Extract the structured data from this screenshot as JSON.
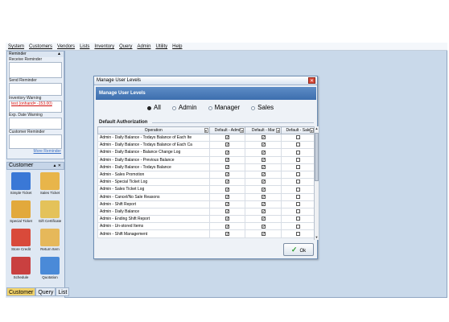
{
  "menu": [
    "System",
    "Customers",
    "Vendors",
    "Lists",
    "Inventory",
    "Query",
    "Admin",
    "Utility",
    "Help"
  ],
  "reminder": {
    "title": "Reminder",
    "receive": "Receive Reminder",
    "send": "Send Reminder",
    "inventory_warning": "Inventory Warning",
    "inventory_warning_item": "test (onhand= -153.00)",
    "exp_date_warning": "Exp. Date Warning",
    "customer_reminder": "Customer Reminder",
    "more_link": "More Reminder"
  },
  "customer_panel": {
    "title": "Customer",
    "tiles": [
      {
        "label": "Simple Ticket",
        "color": "#3a78d6"
      },
      {
        "label": "Sales Ticket",
        "color": "#e8b54a"
      },
      {
        "label": "Special Ticket",
        "color": "#e2a93c"
      },
      {
        "label": "Gift Certificate",
        "color": "#e4c25a"
      },
      {
        "label": "Store Credit",
        "color": "#d94a3a"
      },
      {
        "label": "Return Item",
        "color": "#e6b85a"
      },
      {
        "label": "Schedule",
        "color": "#c94040"
      },
      {
        "label": "Quotation",
        "color": "#4a8ad8"
      }
    ],
    "tabs": [
      "Customer",
      "Query",
      "List"
    ],
    "active_tab": "Customer"
  },
  "dialog": {
    "title": "Manage User Levels",
    "banner": "Manage User Levels",
    "radios": [
      {
        "label": "All",
        "checked": true
      },
      {
        "label": "Admin",
        "checked": false
      },
      {
        "label": "Manager",
        "checked": false
      },
      {
        "label": "Sales",
        "checked": false
      }
    ],
    "group_label": "Default Authorization",
    "columns": [
      "Operation",
      "Default - Admi",
      "Default - Mar",
      "Default - Sale"
    ],
    "rows": [
      {
        "op": "Admin - Daily Balance - Todays Balance of Each Ite",
        "admin": true,
        "mgr": true,
        "sales": false
      },
      {
        "op": "Admin - Daily Balance - Todays Balance of Each Ca",
        "admin": true,
        "mgr": true,
        "sales": false
      },
      {
        "op": "Admin - Daily Balance - Balance Change Log",
        "admin": true,
        "mgr": true,
        "sales": false
      },
      {
        "op": "Admin - Daily Balance - Previous Balance",
        "admin": true,
        "mgr": true,
        "sales": false
      },
      {
        "op": "Admin - Daily Balance - Todays Balance",
        "admin": true,
        "mgr": true,
        "sales": false
      },
      {
        "op": "Admin - Sales Promotion",
        "admin": true,
        "mgr": true,
        "sales": false
      },
      {
        "op": "Admin - Special Ticket Log",
        "admin": true,
        "mgr": true,
        "sales": false
      },
      {
        "op": "Admin - Sales Ticket Log",
        "admin": true,
        "mgr": true,
        "sales": false
      },
      {
        "op": "Admin - Cancel/No Sale Reasons",
        "admin": true,
        "mgr": true,
        "sales": false
      },
      {
        "op": "Admin - Shift Report",
        "admin": true,
        "mgr": true,
        "sales": false
      },
      {
        "op": "Admin - Daily Balance",
        "admin": true,
        "mgr": true,
        "sales": false
      },
      {
        "op": "Admin - Ending Shift Report",
        "admin": true,
        "mgr": true,
        "sales": false
      },
      {
        "op": "Admin - Un-stored Items",
        "admin": true,
        "mgr": true,
        "sales": false
      },
      {
        "op": "Admin - Shift Management",
        "admin": true,
        "mgr": true,
        "sales": false
      }
    ],
    "ok_label": "Ok"
  }
}
